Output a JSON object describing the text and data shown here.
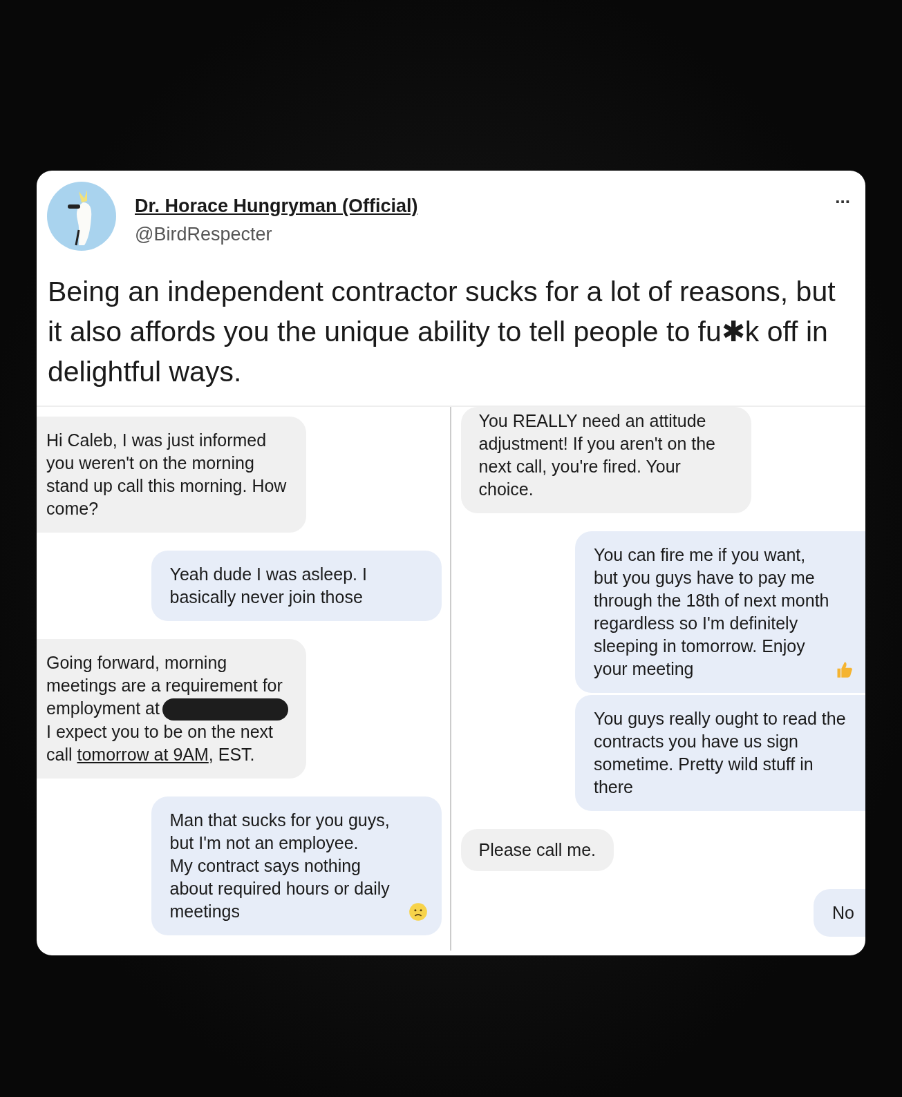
{
  "post": {
    "author": "Dr. Horace Hungryman (Official)",
    "handle": "@BirdRespecter",
    "more": "...",
    "text": "Being an independent contractor sucks for a lot of reasons, but it also affords you the unique ability to tell people to fu✱k off in delightful ways."
  },
  "conversation": {
    "left": [
      {
        "kind": "received",
        "parts": [
          {
            "kind": "text",
            "text": "Hi Caleb, I was just informed you weren't on the morning stand up call this morning. How come?"
          }
        ]
      },
      {
        "kind": "sent",
        "parts": [
          {
            "kind": "text",
            "text": "Yeah dude I was asleep. I basically never join those"
          }
        ]
      },
      {
        "kind": "received",
        "parts": [
          {
            "kind": "text",
            "text": "Going forward, morning meetings are a requirement for employment at"
          },
          {
            "kind": "redaction"
          },
          {
            "kind": "break"
          },
          {
            "kind": "text",
            "text": "I expect you to be on the next call "
          },
          {
            "kind": "link",
            "text": "tomorrow at 9AM"
          },
          {
            "kind": "text",
            "text": ", EST."
          }
        ]
      },
      {
        "kind": "sent",
        "parts": [
          {
            "kind": "text",
            "text": "Man that sucks for you guys, but I'm not an employee."
          },
          {
            "kind": "break"
          },
          {
            "kind": "text",
            "text": "My contract says nothing about required hours or daily meetings"
          },
          {
            "kind": "sad_emoji"
          }
        ]
      }
    ],
    "right": [
      {
        "kind": "received",
        "parts": [
          {
            "kind": "text",
            "text": "You REALLY need an attitude adjustment! If you aren't on the next call, you're fired. Your choice."
          }
        ]
      },
      {
        "kind": "sent",
        "parts": [
          {
            "kind": "text",
            "text": "You can fire me if you want, but you guys have to pay me through the 18th of next month regardless so I'm definitely sleeping in tomorrow. Enjoy your meeting"
          },
          {
            "kind": "thumbs_emoji"
          }
        ]
      },
      {
        "kind": "sent",
        "parts": [
          {
            "kind": "text",
            "text": "You guys really ought to read the contracts you have us sign sometime. Pretty wild stuff in there"
          }
        ]
      },
      {
        "kind": "received",
        "parts": [
          {
            "kind": "text",
            "text": "Please call me."
          }
        ]
      },
      {
        "kind": "sent",
        "parts": [
          {
            "kind": "text",
            "text": "No"
          }
        ]
      }
    ]
  }
}
